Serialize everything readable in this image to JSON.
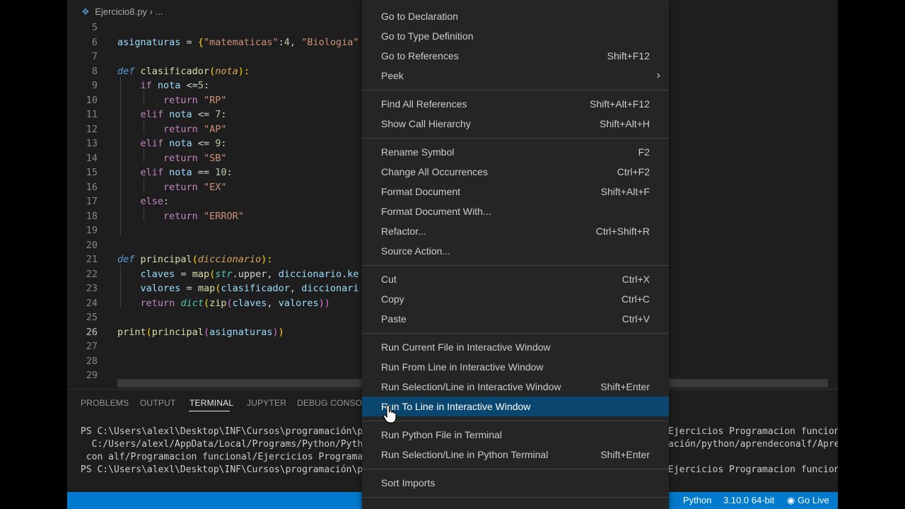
{
  "breadcrumb": {
    "file": "Ejercicio8.py",
    "separator": "›",
    "more": "..."
  },
  "editor": {
    "active_line": 26,
    "lines": [
      {
        "n": "5"
      },
      {
        "n": "6"
      },
      {
        "n": "7"
      },
      {
        "n": "8"
      },
      {
        "n": "9"
      },
      {
        "n": "10"
      },
      {
        "n": "11"
      },
      {
        "n": "12"
      },
      {
        "n": "13"
      },
      {
        "n": "14"
      },
      {
        "n": "15"
      },
      {
        "n": "16"
      },
      {
        "n": "17"
      },
      {
        "n": "18"
      },
      {
        "n": "19"
      },
      {
        "n": "20"
      },
      {
        "n": "21"
      },
      {
        "n": "22"
      },
      {
        "n": "23"
      },
      {
        "n": "24"
      },
      {
        "n": "25"
      },
      {
        "n": "26"
      },
      {
        "n": "27"
      },
      {
        "n": "28"
      },
      {
        "n": "29"
      }
    ],
    "code": {
      "l6": [
        "asignaturas",
        "=",
        "{",
        "\"matematicas\"",
        ":",
        "4",
        ",",
        "\"Biologia\""
      ],
      "l8": [
        "def",
        "clasificador",
        "(",
        "nota",
        "):"
      ],
      "l9": [
        "if",
        "nota",
        "<=",
        "5",
        ":"
      ],
      "l10": [
        "return",
        "\"RP\""
      ],
      "l11": [
        "elif",
        "nota",
        "<=",
        "7",
        ":"
      ],
      "l12": [
        "return",
        "\"AP\""
      ],
      "l13": [
        "elif",
        "nota",
        "<=",
        "9",
        ":"
      ],
      "l14": [
        "return",
        "\"SB\""
      ],
      "l15": [
        "elif",
        "nota",
        "==",
        "10",
        ":"
      ],
      "l16": [
        "return",
        "\"EX\""
      ],
      "l17": [
        "else",
        ":"
      ],
      "l18": [
        "return",
        "\"ERROR\""
      ],
      "l21": [
        "def",
        "principal",
        "(",
        "diccionario",
        "):"
      ],
      "l22": [
        "claves",
        "=",
        "map",
        "(",
        "str",
        ".upper,",
        "diccionario.ke"
      ],
      "l23": [
        "valores",
        "=",
        "map",
        "(",
        "clasificador",
        ",",
        "diccionari"
      ],
      "l24": [
        "return",
        "dict",
        "(",
        "zip",
        "(",
        "claves",
        ",",
        "valores",
        "))"
      ],
      "l26": [
        "print",
        "(",
        "principal",
        "(",
        "asignaturas",
        ")",
        ")"
      ]
    }
  },
  "panel": {
    "tabs": [
      "PROBLEMS",
      "OUTPUT",
      "TERMINAL",
      "JUPYTER",
      "DEBUG CONSOLE"
    ],
    "active_tab": "TERMINAL",
    "terminal_left": [
      "PS C:\\Users\\alexl\\Desktop\\INF\\Cursos\\programación\\pyt",
      "  C:/Users/alexl/AppData/Local/Programs/Python/Python",
      " con alf/Programacion funcional/Ejercicios Programaci",
      "PS C:\\Users\\alexl\\Desktop\\INF\\Cursos\\programación\\pyt"
    ],
    "terminal_right": [
      "Ejercicios Programacion funciona",
      "ación/python/aprendeconalf/Apren",
      "",
      "Ejercicios Programacion funciona"
    ]
  },
  "statusbar": {
    "language": "Python",
    "interpreter": "3.10.0 64-bit",
    "live": "Go Live"
  },
  "menu": {
    "items": [
      {
        "label": "Go to Declaration",
        "key": ""
      },
      {
        "label": "Go to Type Definition",
        "key": ""
      },
      {
        "label": "Go to References",
        "key": "Shift+F12"
      },
      {
        "label": "Peek",
        "key": "",
        "submenu": true
      },
      {
        "label": "Find All References",
        "key": "Shift+Alt+F12"
      },
      {
        "label": "Show Call Hierarchy",
        "key": "Shift+Alt+H"
      },
      {
        "label": "Rename Symbol",
        "key": "F2"
      },
      {
        "label": "Change All Occurrences",
        "key": "Ctrl+F2"
      },
      {
        "label": "Format Document",
        "key": "Shift+Alt+F"
      },
      {
        "label": "Format Document With...",
        "key": ""
      },
      {
        "label": "Refactor...",
        "key": "Ctrl+Shift+R"
      },
      {
        "label": "Source Action...",
        "key": ""
      },
      {
        "label": "Cut",
        "key": "Ctrl+X"
      },
      {
        "label": "Copy",
        "key": "Ctrl+C"
      },
      {
        "label": "Paste",
        "key": "Ctrl+V"
      },
      {
        "label": "Run Current File in Interactive Window",
        "key": ""
      },
      {
        "label": "Run From Line in Interactive Window",
        "key": ""
      },
      {
        "label": "Run Selection/Line in Interactive Window",
        "key": "Shift+Enter"
      },
      {
        "label": "Run To Line in Interactive Window",
        "key": "",
        "highlighted": true
      },
      {
        "label": "Run Python File in Terminal",
        "key": ""
      },
      {
        "label": "Run Selection/Line in Python Terminal",
        "key": "Shift+Enter"
      },
      {
        "label": "Sort Imports",
        "key": ""
      }
    ]
  },
  "colors": {
    "accent": "#007acc",
    "menu_highlight": "#094771",
    "menu_bg": "#252526",
    "editor_bg": "#1e1e1e"
  }
}
